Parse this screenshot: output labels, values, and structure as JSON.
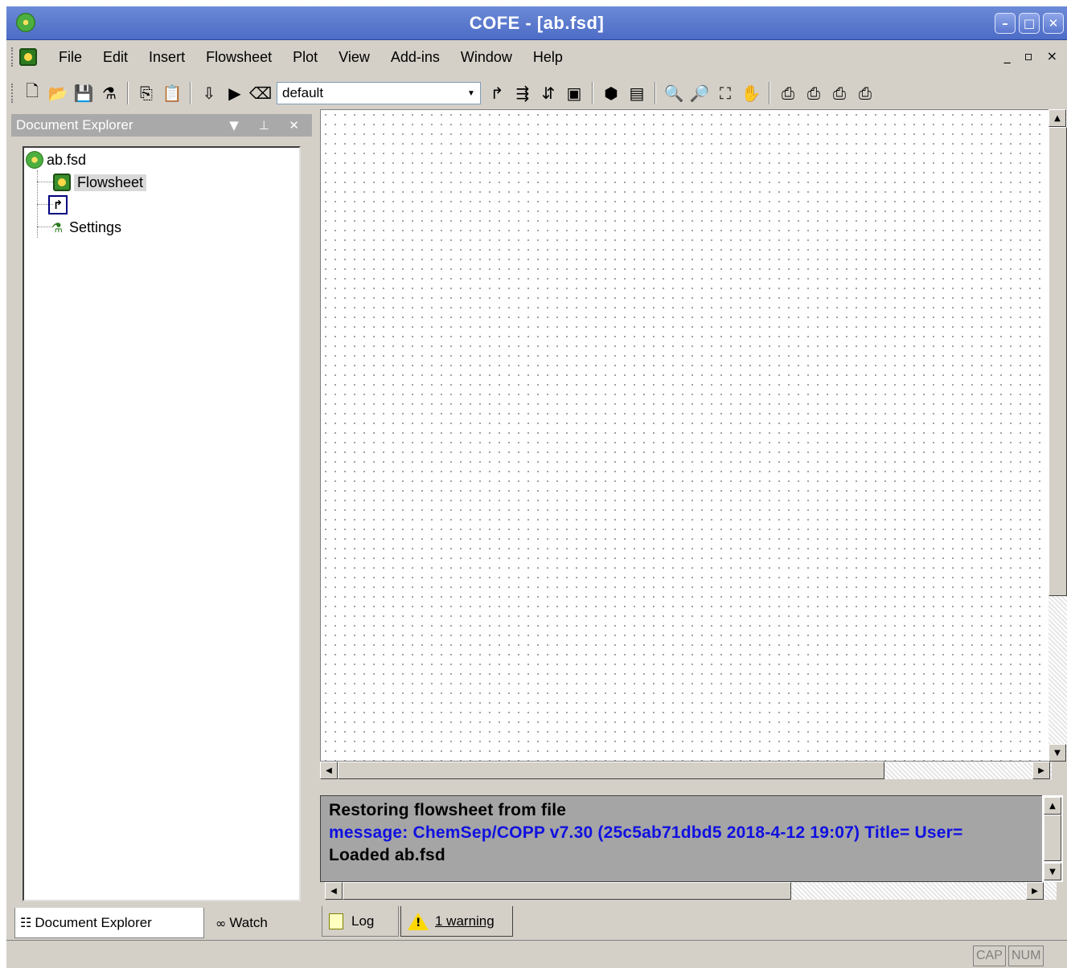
{
  "window": {
    "title": "COFE - [ab.fsd]",
    "buttons": [
      "–",
      "□",
      "✕"
    ]
  },
  "menu": {
    "items": [
      "File",
      "Edit",
      "Insert",
      "Flowsheet",
      "Plot",
      "View",
      "Add-ins",
      "Window",
      "Help"
    ],
    "mdi_controls": "_ ▫ ×"
  },
  "toolbar": {
    "combo_value": "default",
    "combo_arrow": "▼"
  },
  "explorer": {
    "header": "Document Explorer",
    "header_controls": "▼ ⊥ ✕",
    "tree": {
      "root": "ab.fsd",
      "flowsheet": "Flowsheet",
      "stream_icon": "↱",
      "settings": "Settings"
    },
    "tabs": {
      "document_explorer": "Document Explorer",
      "watch": "Watch"
    }
  },
  "log": {
    "lines": [
      "Restoring flowsheet from file",
      "message: ChemSep/COPP v7.30 (25c5ab71dbd5 2018-4-12 19:07) Title= User=",
      "Loaded ab.fsd"
    ],
    "tabs": {
      "log": "Log",
      "warnings": "1 warning",
      "warning_mark": "!"
    }
  },
  "status": {
    "cap": "CAP",
    "num": "NUM"
  },
  "icons": {
    "accent_title": "#4d6cc6",
    "log_blue": "#1010e0"
  }
}
